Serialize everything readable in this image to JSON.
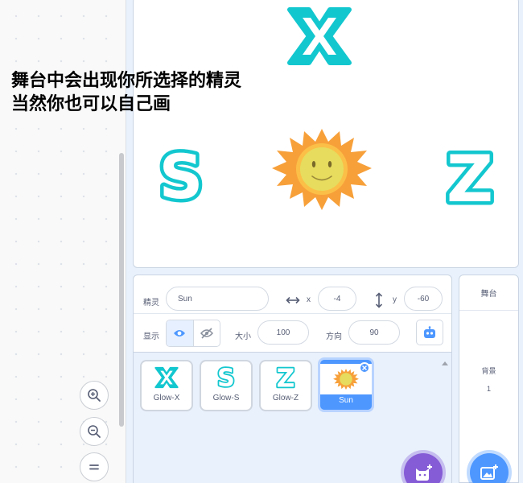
{
  "tutorial": {
    "line1": "舞台中会出现你所选择的精灵",
    "line2": "当然你也可以自己画"
  },
  "sprite_info": {
    "sprite_label": "精灵",
    "sprite_name": "Sun",
    "x_label": "x",
    "x_value": "-4",
    "y_label": "y",
    "y_value": "-60",
    "show_label": "显示",
    "size_label": "大小",
    "size_value": "100",
    "direction_label": "方向",
    "direction_value": "90"
  },
  "sprites": [
    {
      "name": "Glow-X",
      "glyph": "X"
    },
    {
      "name": "Glow-S",
      "glyph": "S"
    },
    {
      "name": "Glow-Z",
      "glyph": "Z"
    },
    {
      "name": "Sun",
      "glyph": "sun",
      "selected": true
    }
  ],
  "stage_panel": {
    "title": "舞台",
    "backdrops_label": "背景",
    "backdrops_count": "1"
  },
  "colors": {
    "accent_blue": "#4d97ff",
    "accent_purple": "#855cd6",
    "glow_cyan": "#13c7cf",
    "sun_orange": "#f8a939",
    "sun_face": "#e6dc5b"
  }
}
